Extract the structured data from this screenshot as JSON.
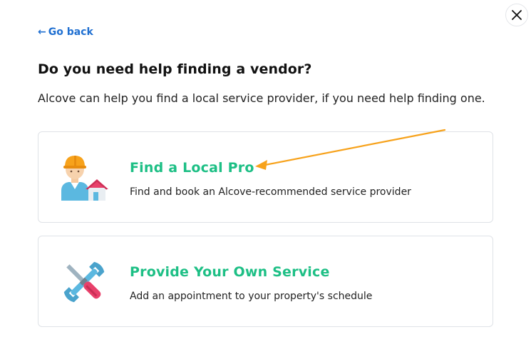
{
  "modal": {
    "back_label": "Go back",
    "back_arrow": "←",
    "title": "Do you need help finding a vendor?",
    "subtitle": "Alcove can help you find a local service provider, if you need help finding one.",
    "close_icon": "close-icon"
  },
  "options": [
    {
      "title": "Find a Local Pro",
      "description": "Find and book an Alcove-recommended service provider",
      "icon": "worker-house-icon"
    },
    {
      "title": "Provide Your Own Service",
      "description": "Add an appointment to your property's schedule",
      "icon": "tools-icon"
    }
  ],
  "colors": {
    "accent_green": "#1dbf85",
    "link_blue": "#1f6fd1",
    "annotation_orange": "#f7a21b"
  }
}
